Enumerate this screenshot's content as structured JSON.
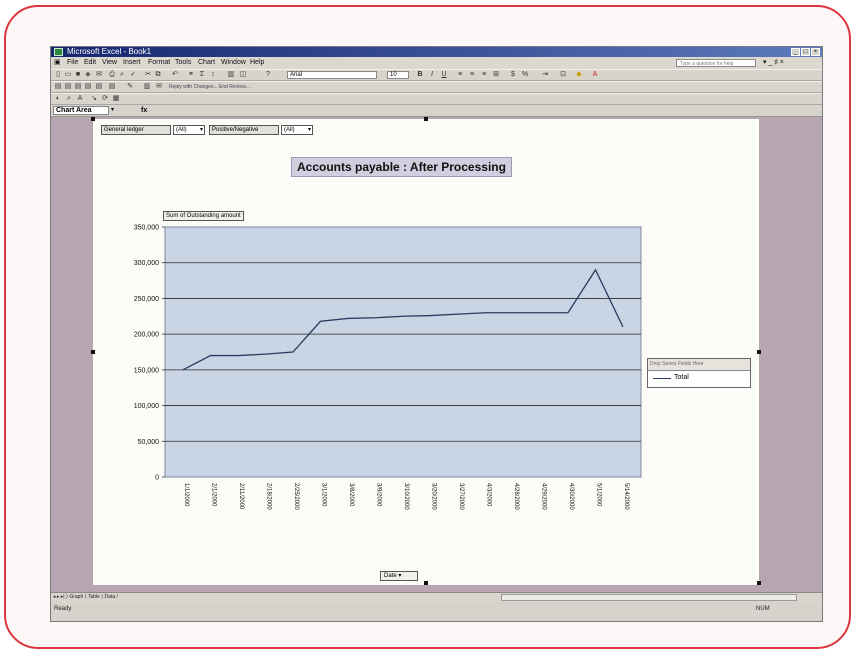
{
  "window": {
    "title": "Microsoft Excel - Book1",
    "buttons": [
      "_",
      "□",
      "×"
    ]
  },
  "menubar": {
    "items": [
      "File",
      "Edit",
      "View",
      "Insert",
      "Format",
      "Tools",
      "Chart",
      "Window",
      "Help"
    ],
    "help_placeholder": "Type a question for help",
    "close": "▾ _ ♯ ×"
  },
  "toolbar": {
    "font": "Arial",
    "size": "10",
    "bold": "B",
    "italic": "I",
    "underline": "U",
    "reply_text": "Reply with Changes... End Review..."
  },
  "formula_bar": {
    "name_box": "Chart Area",
    "fx": "fx"
  },
  "pivot": {
    "page_fields": [
      {
        "label": "General ledger",
        "value": "(All)"
      },
      {
        "label": "Positive/Negative",
        "value": "(All)"
      }
    ],
    "data_field": "Sum of Outstanding amount",
    "category_field": "Date",
    "series_drop_label": "Drop Series Fields Here"
  },
  "chart_data": {
    "type": "line",
    "title": "Accounts payable : After Processing",
    "x": [
      "1/1/2000",
      "2/1/2000",
      "2/11/2000",
      "2/18/2000",
      "2/25/2000",
      "3/1/2000",
      "3/8/2000",
      "3/9/2000",
      "3/10/2000",
      "3/20/2000",
      "3/27/2000",
      "4/3/2000",
      "4/28/2000",
      "4/29/2000",
      "4/30/2000",
      "5/1/2000",
      "5/14/2000"
    ],
    "series": [
      {
        "name": "Total",
        "values": [
          150000,
          170000,
          170000,
          172000,
          175000,
          218000,
          222000,
          223000,
          225000,
          226000,
          228000,
          230000,
          230000,
          230000,
          230000,
          290000,
          210000
        ]
      }
    ],
    "ylim": [
      0,
      350000
    ],
    "yticks": [
      "0",
      "50,000",
      "100,000",
      "150,000",
      "200,000",
      "250,000",
      "300,000",
      "350,000"
    ],
    "grid": true,
    "legend": "right",
    "colors": {
      "line": "#2a3a5e",
      "plot_bg": "#c9d4e4",
      "grid": "#2b2b2b"
    }
  },
  "sheet_tabs": {
    "tabs_text": "◂ ▸ ▸| ⟩ Graph ⟨ Table ⟨ Data /"
  },
  "status": {
    "ready": "Ready",
    "num": "NUM"
  }
}
